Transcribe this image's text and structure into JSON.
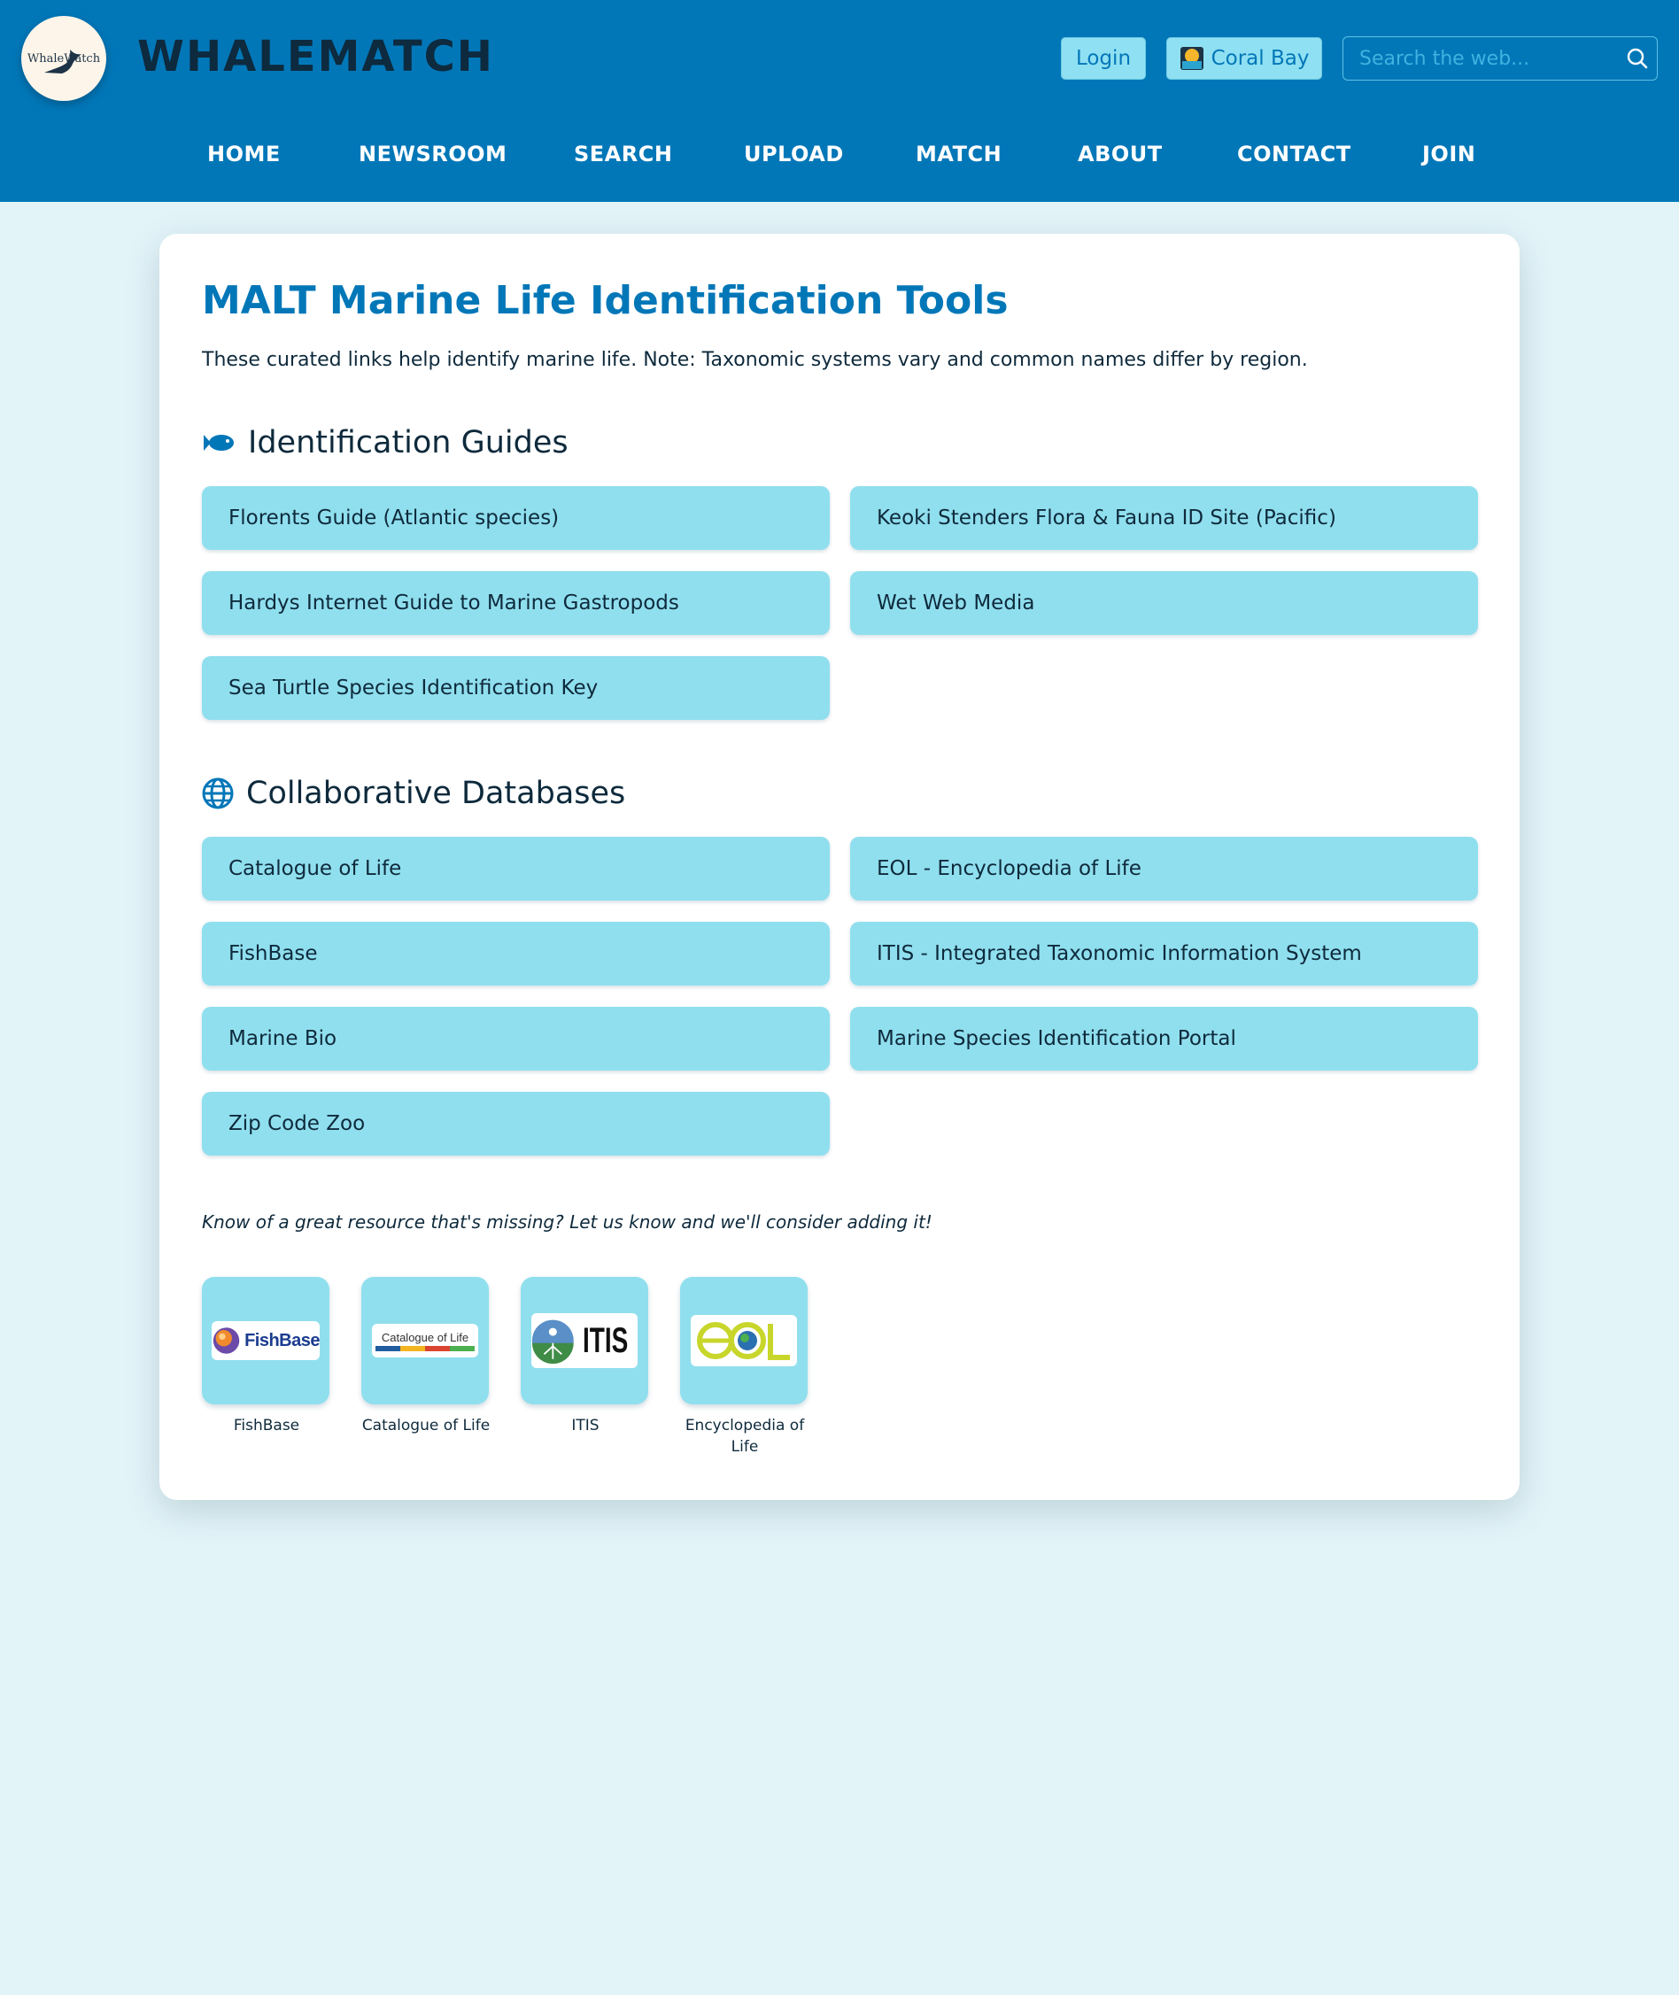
{
  "header": {
    "logo_text": "WhaleWatch",
    "brand": "WHALEMATCH",
    "login_label": "Login",
    "location_label": "Coral Bay",
    "search_placeholder": "Search the web..."
  },
  "nav": {
    "items": [
      "HOME",
      "NEWSROOM",
      "SEARCH",
      "UPLOAD",
      "MATCH",
      "ABOUT",
      "CONTACT",
      "JOIN"
    ]
  },
  "main": {
    "title": "MALT Marine Life Identification Tools",
    "intro": "These curated links help identify marine life. Note: Taxonomic systems vary and common names differ by region.",
    "sections": [
      {
        "heading": "Identification Guides",
        "icon": "fish-icon",
        "links": [
          "Florents Guide (Atlantic species)",
          "Keoki Stenders Flora & Fauna ID Site (Pacific)",
          "Hardys Internet Guide to Marine Gastropods",
          "Wet Web Media",
          "Sea Turtle Species Identification Key"
        ]
      },
      {
        "heading": "Collaborative Databases",
        "icon": "globe-icon",
        "links": [
          "Catalogue of Life",
          "EOL - Encyclopedia of Life",
          "FishBase",
          "ITIS - Integrated Taxonomic Information System",
          "Marine Bio",
          "Marine Species Identification Portal",
          "Zip Code Zoo"
        ]
      }
    ],
    "note": "Know of a great resource that's missing? Let us know and we'll consider adding it!",
    "tiles": [
      {
        "caption": "FishBase",
        "logo_text": "FishBase"
      },
      {
        "caption": "Catalogue of Life",
        "logo_text": "Catalogue of Life"
      },
      {
        "caption": "ITIS",
        "logo_text": "ITIS"
      },
      {
        "caption": "Encyclopedia of Life",
        "logo_text": "eOL"
      }
    ]
  },
  "colors": {
    "header_bg": "#0277b8",
    "page_bg": "#e3f4f9",
    "link_bg": "#90dfee",
    "title": "#0277b8"
  }
}
